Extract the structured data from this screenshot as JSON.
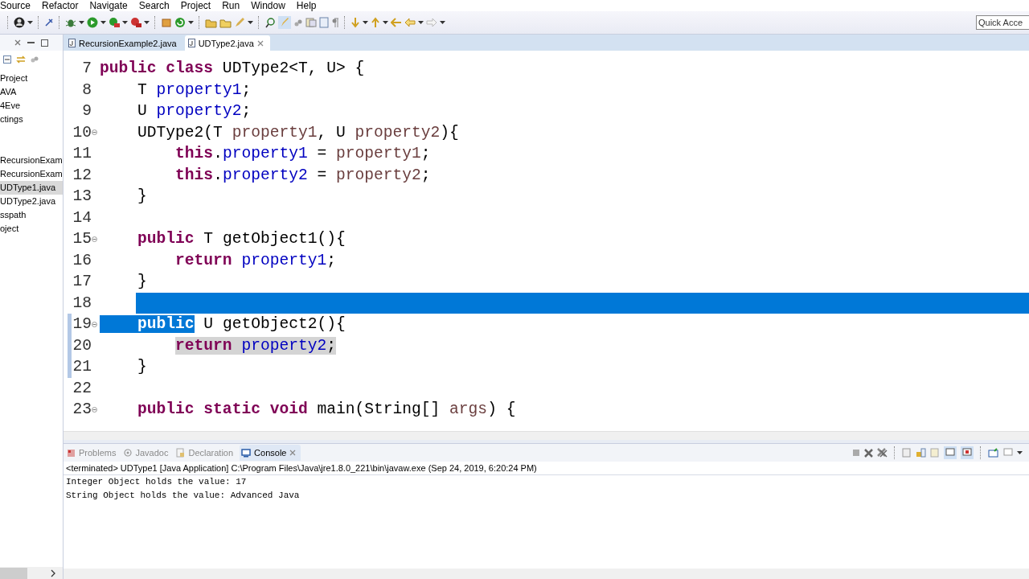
{
  "menu": [
    "Source",
    "Refactor",
    "Navigate",
    "Search",
    "Project",
    "Run",
    "Window",
    "Help"
  ],
  "quick_access": {
    "placeholder": "Quick Acce"
  },
  "explorer": {
    "items": [
      {
        "label": "Project",
        "selected": false
      },
      {
        "label": "AVA",
        "selected": false
      },
      {
        "label": "4Eve",
        "selected": false
      },
      {
        "label": "ctings",
        "selected": false
      },
      {
        "label": "RecursionExam",
        "selected": false
      },
      {
        "label": "RecursionExam",
        "selected": false
      },
      {
        "label": "UDType1.java",
        "selected": true
      },
      {
        "label": "UDType2.java",
        "selected": false
      },
      {
        "label": "sspath",
        "selected": false
      },
      {
        "label": "oject",
        "selected": false
      }
    ]
  },
  "editor": {
    "tabs": [
      {
        "label": "RecursionExample2.java",
        "selected": false
      },
      {
        "label": "UDType2.java",
        "selected": true
      }
    ],
    "lines": [
      {
        "number": "7",
        "foldable": false,
        "marked": false,
        "selected": false,
        "tokens": [
          {
            "text": "public class",
            "kind": "keyword",
            "selected": false
          },
          {
            "text": " UDType2<T, U> {",
            "kind": "plain",
            "selected": false
          }
        ]
      },
      {
        "number": "8",
        "foldable": false,
        "marked": false,
        "selected": false,
        "tokens": [
          {
            "text": "    T ",
            "kind": "plain",
            "selected": false
          },
          {
            "text": "property1",
            "kind": "field",
            "selected": false
          },
          {
            "text": ";",
            "kind": "plain",
            "selected": false
          }
        ]
      },
      {
        "number": "9",
        "foldable": false,
        "marked": false,
        "selected": false,
        "tokens": [
          {
            "text": "    U ",
            "kind": "plain",
            "selected": false
          },
          {
            "text": "property2",
            "kind": "field",
            "selected": false
          },
          {
            "text": ";",
            "kind": "plain",
            "selected": false
          }
        ]
      },
      {
        "number": "10",
        "foldable": true,
        "marked": false,
        "selected": false,
        "tokens": [
          {
            "text": "    UDType2(T ",
            "kind": "plain",
            "selected": false
          },
          {
            "text": "property1",
            "kind": "param",
            "selected": false
          },
          {
            "text": ", U ",
            "kind": "plain",
            "selected": false
          },
          {
            "text": "property2",
            "kind": "param",
            "selected": false
          },
          {
            "text": "){",
            "kind": "plain",
            "selected": false
          }
        ]
      },
      {
        "number": "11",
        "foldable": false,
        "marked": false,
        "selected": false,
        "tokens": [
          {
            "text": "        this",
            "kind": "keyword",
            "selected": false
          },
          {
            "text": ".",
            "kind": "plain",
            "selected": false
          },
          {
            "text": "property1",
            "kind": "field",
            "selected": false
          },
          {
            "text": " = ",
            "kind": "plain",
            "selected": false
          },
          {
            "text": "property1",
            "kind": "param",
            "selected": false
          },
          {
            "text": ";",
            "kind": "plain",
            "selected": false
          }
        ]
      },
      {
        "number": "12",
        "foldable": false,
        "marked": false,
        "selected": false,
        "tokens": [
          {
            "text": "        this",
            "kind": "keyword",
            "selected": false
          },
          {
            "text": ".",
            "kind": "plain",
            "selected": false
          },
          {
            "text": "property2",
            "kind": "field",
            "selected": false
          },
          {
            "text": " = ",
            "kind": "plain",
            "selected": false
          },
          {
            "text": "property2",
            "kind": "param",
            "selected": false
          },
          {
            "text": ";",
            "kind": "plain",
            "selected": false
          }
        ]
      },
      {
        "number": "13",
        "foldable": false,
        "marked": false,
        "selected": false,
        "tokens": [
          {
            "text": "    }",
            "kind": "plain",
            "selected": false
          }
        ]
      },
      {
        "number": "14",
        "foldable": false,
        "marked": false,
        "selected": false
      },
      {
        "number": "15",
        "foldable": true,
        "marked": false,
        "selected": false,
        "tokens": [
          {
            "text": "    public",
            "kind": "keyword",
            "selected": false
          },
          {
            "text": " T getObject1(){",
            "kind": "plain",
            "selected": false
          }
        ]
      },
      {
        "number": "16",
        "foldable": false,
        "marked": false,
        "selected": false,
        "tokens": [
          {
            "text": "        return",
            "kind": "keyword",
            "selected": false
          },
          {
            "text": " property1",
            "kind": "field",
            "selected": false
          },
          {
            "text": ";",
            "kind": "plain",
            "selected": false
          }
        ]
      },
      {
        "number": "17",
        "foldable": false,
        "marked": false,
        "selected": false,
        "tokens": [
          {
            "text": "    }",
            "kind": "plain",
            "selected": false
          }
        ]
      },
      {
        "number": "18",
        "foldable": false,
        "marked": false,
        "selected": true
      },
      {
        "number": "19",
        "foldable": true,
        "marked": true,
        "selected": false,
        "tokens": [
          {
            "text": "    public",
            "kind": "keyword",
            "selected": true
          },
          {
            "text": " U getObject2(){",
            "kind": "plain",
            "selected": false
          }
        ]
      },
      {
        "number": "20",
        "foldable": false,
        "marked": true,
        "selected": false,
        "highlighted": true,
        "tokens": [
          {
            "text": "        return",
            "kind": "keyword",
            "selected": false
          },
          {
            "text": " property2",
            "kind": "field",
            "selected": false
          },
          {
            "text": ";",
            "kind": "plain",
            "selected": false
          }
        ]
      },
      {
        "number": "21",
        "foldable": false,
        "marked": true,
        "selected": false,
        "tokens": [
          {
            "text": "    }",
            "kind": "plain",
            "selected": false
          }
        ]
      },
      {
        "number": "22",
        "foldable": false,
        "marked": false,
        "selected": false
      },
      {
        "number": "23",
        "foldable": true,
        "marked": false,
        "selected": false,
        "tokens": [
          {
            "text": "    public static void",
            "kind": "keyword",
            "selected": false
          },
          {
            "text": " main(String[] ",
            "kind": "plain",
            "selected": false
          },
          {
            "text": "args",
            "kind": "param",
            "selected": false
          },
          {
            "text": ") {",
            "kind": "plain",
            "selected": false
          }
        ]
      }
    ]
  },
  "bottom_panel": {
    "tabs": [
      {
        "label": "Problems",
        "kind": "problems",
        "selected": false
      },
      {
        "label": "Javadoc",
        "kind": "javadoc",
        "selected": false
      },
      {
        "label": "Declaration",
        "kind": "declaration",
        "selected": false
      },
      {
        "label": "Console",
        "kind": "console",
        "selected": true
      }
    ],
    "console": {
      "header": "<terminated> UDType1 [Java Application] C:\\Program Files\\Java\\jre1.8.0_221\\bin\\javaw.exe (Sep 24, 2019, 6:20:24 PM)",
      "output": [
        "Integer Object holds the value: 17",
        "String Object holds the value: Advanced Java"
      ]
    }
  }
}
